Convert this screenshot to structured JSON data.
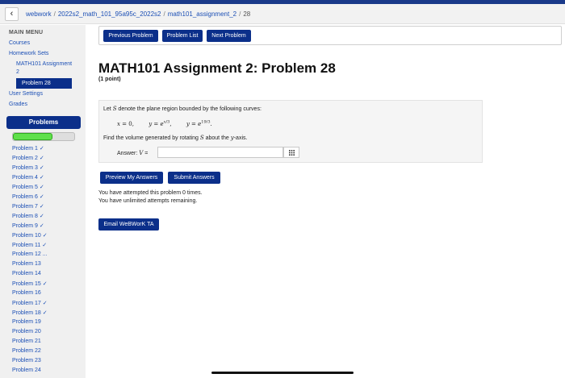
{
  "breadcrumb": {
    "back_icon": "chevron-left-icon",
    "items": [
      "webwork",
      "2022s2_math_101_95a95c_2022s2",
      "math101_assignment_2",
      "28"
    ],
    "separator": "/"
  },
  "sidebar": {
    "menu_title": "MAIN MENU",
    "courses": "Courses",
    "homework_sets": "Homework Sets",
    "assignment_line1": "MATH101 Assignment",
    "assignment_line2": "2",
    "active_problem": "Problem 28",
    "user_settings": "User Settings",
    "grades": "Grades",
    "problems_header": "Problems",
    "progress_fraction": 0.65,
    "problems": [
      "Problem 1 ✓",
      "Problem 2 ✓",
      "Problem 3 ✓",
      "Problem 4 ✓",
      "Problem 5 ✓",
      "Problem 6 ✓",
      "Problem 7 ✓",
      "Problem 8 ✓",
      "Problem 9 ✓",
      "Problem 10 ✓",
      "Problem 11 ✓",
      "Problem 12 ...",
      "Problem 13",
      "Problem 14",
      "Problem 15 ✓",
      "Problem 16",
      "Problem 17 ✓",
      "Problem 18 ✓",
      "Problem 19",
      "Problem 20",
      "Problem 21",
      "Problem 22",
      "Problem 23",
      "Problem 24"
    ]
  },
  "nav": {
    "previous": "Previous Problem",
    "list": "Problem List",
    "next": "Next Problem"
  },
  "main": {
    "title": "MATH101 Assignment 2: Problem 28",
    "points": "(1 point)"
  },
  "problem": {
    "intro_before": "Let ",
    "intro_var": "S",
    "intro_after": " denote the plane region bounded by the following curves:",
    "eq1": "x = 0,",
    "eq2": "y = e^(x/3),",
    "eq3": "y = e^(19/3).",
    "question_before": "Find the volume generated by rotating ",
    "question_var": "S",
    "question_mid": " about the ",
    "question_axis": "y",
    "question_after": "-axis.",
    "answer_label": "Answer: V =",
    "answer_value": "",
    "keypad_icon": "grid-icon"
  },
  "actions": {
    "preview": "Preview My Answers",
    "submit": "Submit Answers"
  },
  "messages": {
    "attempted": "You have attempted this problem 0 times.",
    "remaining": "You have unlimited attempts remaining."
  },
  "email_button": "Email WeBWorK TA",
  "colors": {
    "accent": "#0b2f8a",
    "link": "#1b4fb5",
    "progress": "#5fe04a"
  }
}
